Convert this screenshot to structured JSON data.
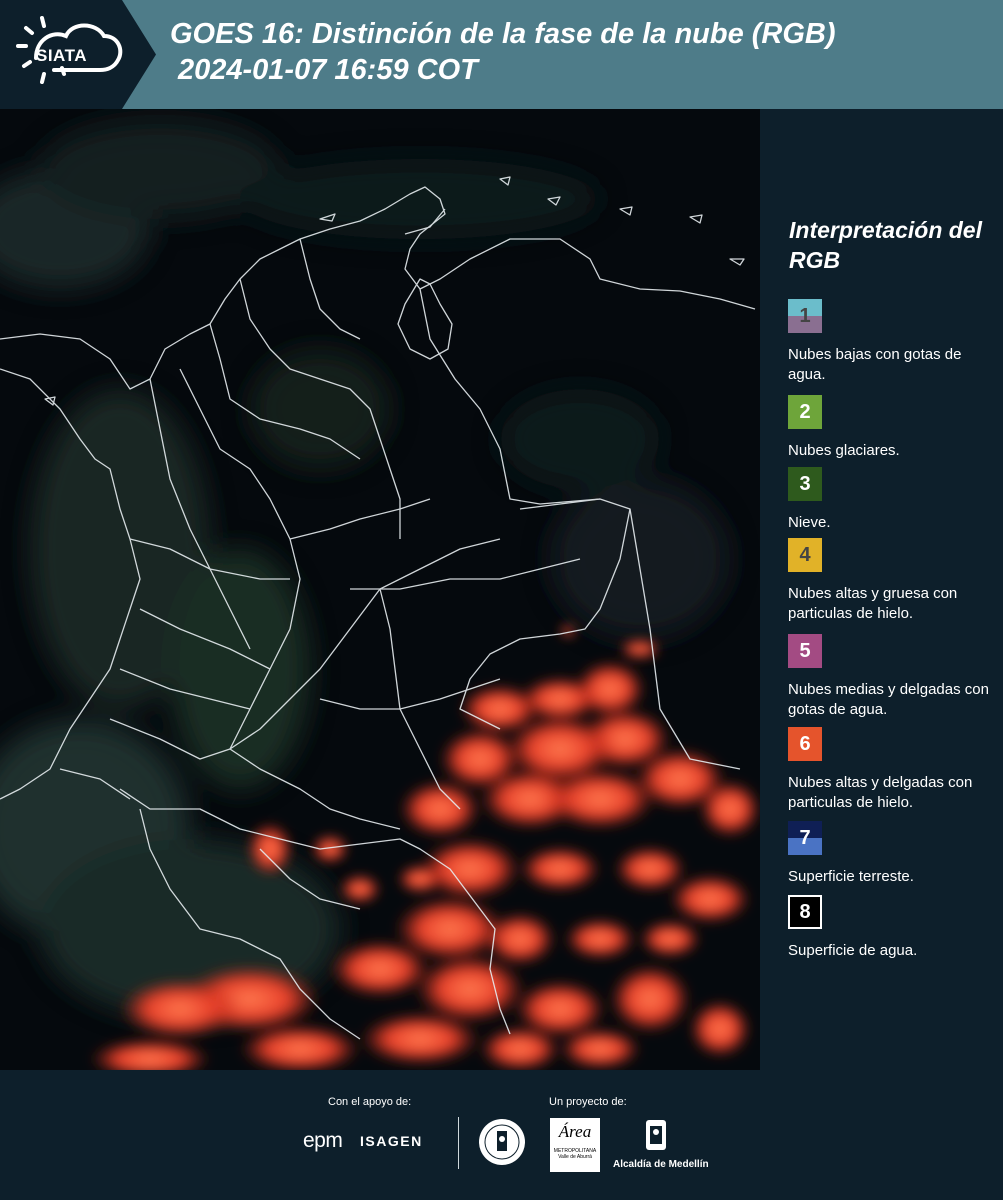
{
  "header": {
    "logo_text": "SIATA",
    "title_line1": "GOES 16: Distinción de la fase de la nube (RGB)",
    "title_line2": "2024-01-07 16:59 COT"
  },
  "legend": {
    "title": "Interpretación del RGB",
    "items": [
      {
        "number": "1",
        "label": "Nubes bajas con gotas de agua."
      },
      {
        "number": "2",
        "label": "Nubes glaciares."
      },
      {
        "number": "3",
        "label": "Nieve."
      },
      {
        "number": "4",
        "label": "Nubes altas y gruesa con particulas de hielo."
      },
      {
        "number": "5",
        "label": "Nubes medias y delgadas con gotas de agua."
      },
      {
        "number": "6",
        "label": "Nubes altas y delgadas con particulas de hielo."
      },
      {
        "number": "7",
        "label": "Superficie terreste."
      },
      {
        "number": "8",
        "label": "Superficie de agua."
      }
    ],
    "colors": {
      "1": [
        "#6bbdcb",
        "#8a6f91"
      ],
      "2": "#6ea53a",
      "3": "#2e5a1d",
      "4": "#e1b228",
      "5": "#a34b83",
      "6": "#e5542c",
      "7": [
        "#0f1f55",
        "#4a73c4"
      ],
      "8": "#000000"
    }
  },
  "footer": {
    "support_label": "Con el apoyo de:",
    "project_label": "Un proyecto de:",
    "sponsors": [
      "epm",
      "ISAGEN"
    ],
    "area_logo": "Área",
    "area_sub": "METROPOLITANA Valle de Aburrá",
    "medellin": "Alcaldía de Medellín"
  },
  "colors": {
    "header_band": "#4e7c89",
    "background": "#0d1f2b",
    "map_background": "#05090d",
    "ice_cloud": "#e8402a"
  }
}
